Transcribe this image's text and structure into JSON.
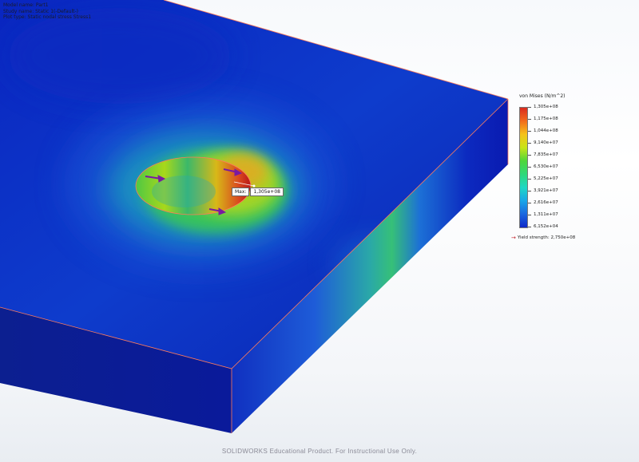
{
  "study_info": {
    "model_name": "Model name: Part1",
    "study_name": "Study name: Static 1(-Default-)",
    "plot_type": "Plot type: Static nodal stress Stress1"
  },
  "legend": {
    "title": "von Mises (N/m^2)",
    "ticks": [
      "1,305e+08",
      "1,175e+08",
      "1,044e+08",
      "9,140e+07",
      "7,835e+07",
      "6,530e+07",
      "5,225e+07",
      "3,921e+07",
      "2,616e+07",
      "1,311e+07",
      "6,152e+04"
    ],
    "yield_strength": "Yield strength: 2,750e+08",
    "colors": [
      "#d92b1f",
      "#f26b1c",
      "#f5c21a",
      "#c8e418",
      "#4fd63a",
      "#2ed879",
      "#1fd7c4",
      "#18a6e8",
      "#1a67e0",
      "#1028c8"
    ]
  },
  "probe": {
    "label": "Max:",
    "value": "1,305e+08"
  },
  "watermark": "SOLIDWORKS Educational Product. For Instructional Use Only.",
  "colors": {
    "low_stress": "#0a1fb4",
    "high_stress": "#d92b1f",
    "edge_line": "#ff7a5a",
    "yield_arrow": "#c0202a"
  }
}
